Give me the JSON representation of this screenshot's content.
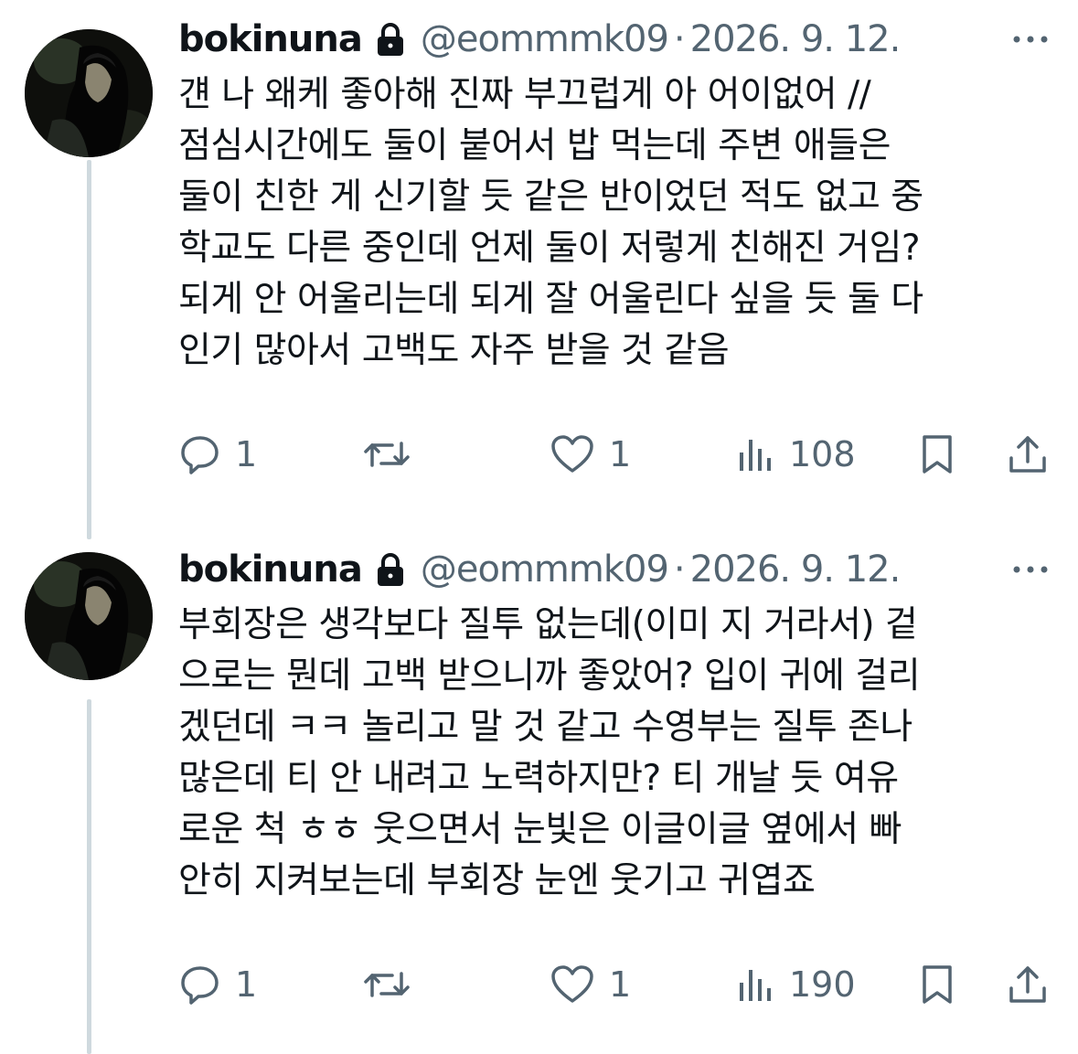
{
  "tweets": [
    {
      "display_name": "bokinuna",
      "handle": "@eommmk09",
      "separator": "·",
      "date": "2026. 9. 12.",
      "text": "걘 나 왜케 좋아해 진짜 부끄럽게 아 어이없어 //\n점심시간에도 둘이 붙어서 밥 먹는데 주변 애들은\n둘이 친한 게 신기할 듯 같은 반이었던 적도 없고 중\n학교도 다른 중인데 언제 둘이 저렇게 친해진 거임?\n되게 안 어울리는데 되게 잘 어울린다 싶을 듯 둘 다\n인기 많아서 고백도 자주 받을 것 같음",
      "reply_count": "1",
      "like_count": "1",
      "view_count": "108",
      "icons": [
        "lock-icon",
        "more-icon",
        "reply-icon",
        "retweet-icon",
        "like-icon",
        "views-icon",
        "bookmark-icon",
        "share-icon"
      ]
    },
    {
      "display_name": "bokinuna",
      "handle": "@eommmk09",
      "separator": "·",
      "date": "2026. 9. 12.",
      "text": "부회장은 생각보다 질투 없는데(이미 지 거라서) 겉\n으로는 뭔데 고백 받으니까 좋았어? 입이 귀에 걸리\n겠던데 ㅋㅋ 놀리고 말 것 같고 수영부는 질투 존나\n많은데 티 안 내려고 노력하지만? 티 개날 듯 여유\n로운 척 ㅎㅎ 웃으면서 눈빛은 이글이글 옆에서 빠\n안히 지켜보는데 부회장 눈엔 웃기고 귀엽죠",
      "reply_count": "1",
      "like_count": "1",
      "view_count": "190",
      "icons": [
        "lock-icon",
        "more-icon",
        "reply-icon",
        "retweet-icon",
        "like-icon",
        "views-icon",
        "bookmark-icon",
        "share-icon"
      ]
    }
  ],
  "colors": {
    "text": "#0f1419",
    "secondary": "#536471",
    "thread_line": "#cfd9de",
    "background": "#ffffff"
  }
}
